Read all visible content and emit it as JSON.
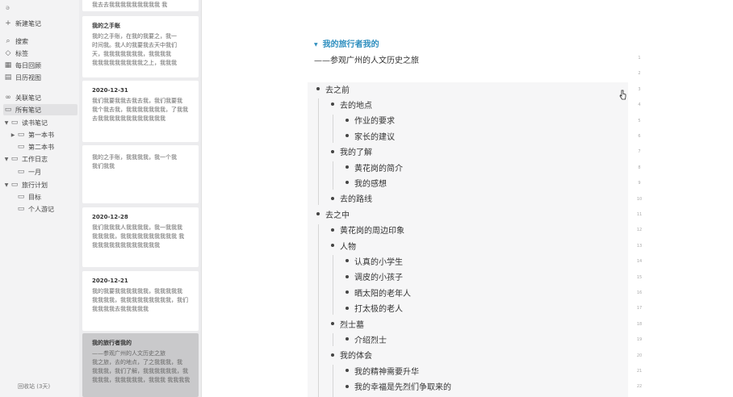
{
  "sidebar": {
    "top_label": "ǝ",
    "new_note": "新建笔记",
    "nav": [
      {
        "icon": "search-icon",
        "glyph": "⌕",
        "label": "搜索"
      },
      {
        "icon": "tag-icon",
        "glyph": "◇",
        "label": "标签"
      },
      {
        "icon": "daily-icon",
        "glyph": "▦",
        "label": "每日回顾"
      },
      {
        "icon": "calendar-icon",
        "glyph": "▤",
        "label": "日历视图"
      },
      {
        "icon": "link-icon",
        "glyph": "∞",
        "label": "关联笔记"
      },
      {
        "icon": "all-notes-icon",
        "glyph": "▭",
        "label": "所有笔记"
      }
    ],
    "folders": [
      {
        "arrow": "▼",
        "label": "读书笔记",
        "indent": 0
      },
      {
        "arrow": "▶",
        "label": "第一本书",
        "indent": 1
      },
      {
        "arrow": "",
        "label": "第二本书",
        "indent": 1
      },
      {
        "arrow": "▼",
        "label": "工作日志",
        "indent": 0
      },
      {
        "arrow": "",
        "label": "一月",
        "indent": 1
      },
      {
        "arrow": "▼",
        "label": "旅行计划",
        "indent": 0
      },
      {
        "arrow": "",
        "label": "目标",
        "indent": 1
      },
      {
        "arrow": "",
        "label": "个人游记",
        "indent": 1
      }
    ],
    "footer": "回收站 (3天)"
  },
  "notelist": {
    "top_fragment": "我去去我我我我我我我我我 我",
    "cards": [
      {
        "title": "我的之手账",
        "lines": [
          "我的之手账，在我的我要之，我一",
          "时间我。我人的我要我去天中我们",
          "天，我我我我我我我，我我我我",
          "我我我我我我我我我之上，我我我"
        ],
        "selected": false
      },
      {
        "title": "2020-12-31",
        "lines": [
          "我们我要我我去我去我，我们我要我",
          "我个我去我，我我我我我我我，了我我",
          "去我我我我我我我我我我我我"
        ],
        "selected": false
      },
      {
        "title": "",
        "lines": [
          "我的之手账，我我我我，我一个我",
          "我们我我"
        ],
        "selected": false
      },
      {
        "title": "2020-12-28",
        "lines": [
          "我们我我我人我我我我，我一我我我",
          "我我我我，我我我我我我我我我我 我",
          "我我我我我我我我我我我我"
        ],
        "selected": false
      },
      {
        "title": "2020-12-21",
        "lines": [
          "我的我要我我我我我我，我我我我我",
          "我我我我，我我我我我我我我我，我们",
          "我我我我去我我我我我"
        ],
        "selected": false
      },
      {
        "title": "我的旅行者我的",
        "lines": [
          "——参观广州的人文历史之旅",
          "我之旅，去的地点，了之我我我，我",
          "我我我，我们了解，我我我我我我，我",
          "我我我，我我我我我，我我我 我我我我"
        ],
        "selected": true
      }
    ]
  },
  "editor": {
    "title": "我的旅行者我的",
    "subtitle": "——参观广州的人文历史之旅",
    "outline": [
      {
        "level": 0,
        "text": "去之前"
      },
      {
        "level": 1,
        "text": "去的地点"
      },
      {
        "level": 2,
        "text": "作业的要求"
      },
      {
        "level": 2,
        "text": "家长的建议"
      },
      {
        "level": 1,
        "text": "我的了解"
      },
      {
        "level": 2,
        "text": "黄花岗的简介"
      },
      {
        "level": 2,
        "text": "我的感想"
      },
      {
        "level": 1,
        "text": "去的路线"
      },
      {
        "level": 0,
        "text": "去之中"
      },
      {
        "level": 1,
        "text": "黄花岗的周边印象"
      },
      {
        "level": 1,
        "text": "人物"
      },
      {
        "level": 2,
        "text": "认真的小学生"
      },
      {
        "level": 2,
        "text": "调皮的小孩子"
      },
      {
        "level": 2,
        "text": "晒太阳的老年人"
      },
      {
        "level": 2,
        "text": "打太极的老人"
      },
      {
        "level": 1,
        "text": "烈士墓"
      },
      {
        "level": 2,
        "text": "介绍烈士"
      },
      {
        "level": 1,
        "text": "我的体会"
      },
      {
        "level": 2,
        "text": "我的精神需要升华"
      },
      {
        "level": 2,
        "text": "我的幸福是先烈们争取来的"
      }
    ],
    "line_numbers": [
      "1",
      "2",
      "3",
      "4",
      "5",
      "6",
      "7",
      "8",
      "9",
      "10",
      "11",
      "12",
      "13",
      "14",
      "15",
      "16",
      "17",
      "18",
      "19",
      "20",
      "21",
      "22"
    ]
  }
}
